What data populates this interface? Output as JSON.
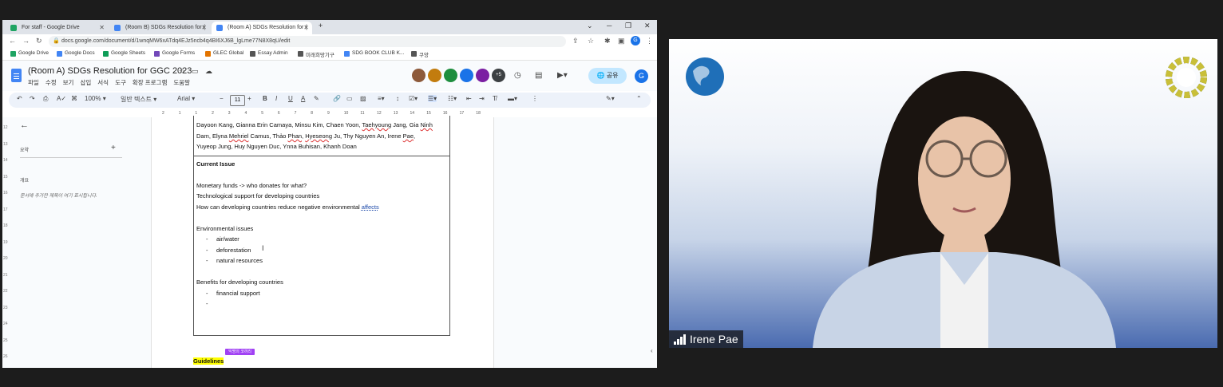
{
  "browser": {
    "tabs": [
      {
        "label": "For staff - Google Drive",
        "icon": "google-drive-icon"
      },
      {
        "label": "(Room B) SDGs Resolution for (",
        "icon": "docs-icon"
      },
      {
        "label": "(Room A) SDGs Resolution for (",
        "icon": "docs-icon"
      }
    ],
    "new_tab": "+",
    "url": "docs.google.com/document/d/1wnqMW6xATdq4EJz5ncb4q4BI6XJ6B_lgLme77N8X8qU/edit",
    "bookmarks": [
      {
        "label": "Google Drive",
        "color": "#1fa463"
      },
      {
        "label": "Google Docs",
        "color": "#4285f4"
      },
      {
        "label": "Google Sheets",
        "color": "#0f9d58"
      },
      {
        "label": "Google Forms",
        "color": "#7248b9"
      },
      {
        "label": "GLEC Global",
        "color": "#e37400"
      },
      {
        "label": "Essay Admin",
        "color": "#555555"
      },
      {
        "label": "미래희망기구",
        "color": "#555555"
      },
      {
        "label": "SDG BOOK CLUB K...",
        "color": "#4285f4"
      },
      {
        "label": "쿠앙",
        "color": "#555555"
      }
    ]
  },
  "docs": {
    "title": "(Room A) SDGs Resolution for GGC 2023",
    "menus": [
      "파일",
      "수정",
      "보기",
      "삽입",
      "서식",
      "도구",
      "확장 프로그램",
      "도움말"
    ],
    "collaborators_more": "+5",
    "share_label": "공유",
    "user_initial": "G",
    "toolbar": {
      "zoom": "100%",
      "style": "일반 텍스트",
      "font": "Arial",
      "font_size": "11"
    },
    "ruler_ticks": [
      "2",
      "1",
      "1",
      "2",
      "3",
      "4",
      "5",
      "6",
      "7",
      "8",
      "9",
      "10",
      "11",
      "12",
      "13",
      "14",
      "15",
      "16",
      "17",
      "18"
    ],
    "left_ruler_ticks": [
      "12",
      "13",
      "14",
      "15",
      "16",
      "17",
      "18",
      "19",
      "20",
      "21",
      "22",
      "23",
      "24",
      "25",
      "26"
    ],
    "outline": {
      "summary_label": "요약",
      "outline_label": "개요",
      "outline_hint": "문서에 추가한 제목이 여기 표시됩니다."
    },
    "content": {
      "participants_line1": [
        "Dayoon Kang, Gianna Erin Camaya, Minsu Kim, Chaen Yoon, ",
        "Taehyoung",
        " Jang, Gia ",
        "Ninh"
      ],
      "participants_line2": [
        "Dam, Elyna ",
        "Mehriel",
        " Camus, Thảo ",
        "Phan",
        ", ",
        "Hyeseong",
        " Ju, Thy Nguyen An, Irene ",
        "Pae",
        ","
      ],
      "participants_line3": "Yuyeop Jung, Huy Nguyen Duc, Ynna Buhisan, Khanh Doan",
      "current_issue_heading": "Current Issue",
      "lines": [
        "Monetary funds -> who donates for what?",
        "Technological support for developing countries"
      ],
      "line3_prefix": "How can developing countries reduce negative environmental ",
      "line3_link": "affects",
      "env_heading": "Environmental issues",
      "env_items": [
        "air/water",
        "deforestation",
        "natural resources"
      ],
      "benefits_heading": "Benefits for developing countries",
      "benefit_items": [
        "financial support",
        ""
      ],
      "bullet": "-",
      "cursor_tag": "익명의 코끼리",
      "guidelines": "Guidelines"
    }
  },
  "video": {
    "participant_name": "Irene Pae"
  },
  "colors": {
    "accent": "#1a73e8",
    "share_bg": "#c2e7ff",
    "cursor_tag": "#a142f4",
    "highlight": "#ffff00"
  }
}
